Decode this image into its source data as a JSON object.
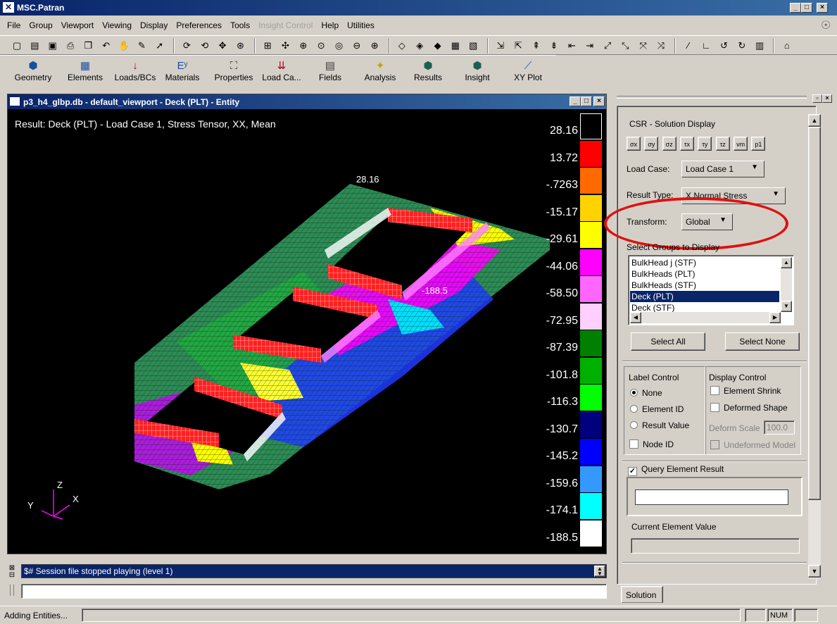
{
  "app": {
    "title": "MSC.Patran"
  },
  "menubar": [
    "File",
    "Group",
    "Viewport",
    "Viewing",
    "Display",
    "Preferences",
    "Tools",
    "Insight Control",
    "Help",
    "Utilities"
  ],
  "appbar": [
    {
      "label": "Geometry",
      "icon": "geometry-icon"
    },
    {
      "label": "Elements",
      "icon": "elements-icon"
    },
    {
      "label": "Loads/BCs",
      "icon": "loads-icon"
    },
    {
      "label": "Materials",
      "icon": "materials-icon"
    },
    {
      "label": "Properties",
      "icon": "properties-icon"
    },
    {
      "label": "Load Ca...",
      "icon": "loadcase-icon"
    },
    {
      "label": "Fields",
      "icon": "fields-icon"
    },
    {
      "label": "Analysis",
      "icon": "analysis-icon"
    },
    {
      "label": "Results",
      "icon": "results-icon"
    },
    {
      "label": "Insight",
      "icon": "insight-icon"
    },
    {
      "label": "XY Plot",
      "icon": "xyplot-icon"
    }
  ],
  "viewport": {
    "title": "p3_h4_glbp.db - default_viewport - Deck (PLT) - Entity",
    "result_text": "Result: Deck (PLT) - Load Case 1, Stress Tensor, XX, Mean",
    "max_marker": "28.16",
    "min_marker": "-188.5",
    "axes": {
      "x": "X",
      "y": "Y",
      "z": "Z"
    }
  },
  "legend": {
    "values": [
      "28.16",
      "13.72",
      "-.7263",
      "-15.17",
      "-29.61",
      "-44.06",
      "-58.50",
      "-72.95",
      "-87.39",
      "-101.8",
      "-116.3",
      "-130.7",
      "-145.2",
      "-159.6",
      "-174.1",
      "-188.5"
    ],
    "colors": [
      "#000000",
      "#ff0000",
      "#ff6a00",
      "#ffd200",
      "#ffff00",
      "#ff00ff",
      "#ff66ff",
      "#ffcfff",
      "#007f00",
      "#00b000",
      "#00ff00",
      "#00007f",
      "#0000ff",
      "#3399ff",
      "#00ffff",
      "#ffffff"
    ]
  },
  "panel": {
    "title": "CSR - Solution Display",
    "load_case_label": "Load Case:",
    "load_case_value": "Load Case 1",
    "result_type_label": "Result Type:",
    "result_type_value": "X Normal Stress",
    "transform_label": "Transform:",
    "transform_value": "Global",
    "groups_label": "Select Groups to Display",
    "groups": [
      "BulkHead j (STF)",
      "BulkHeads (PLT)",
      "BulkHeads (STF)",
      "Deck (PLT)",
      "Deck (STF)"
    ],
    "selected_group": "Deck (PLT)",
    "select_all": "Select All",
    "select_none": "Select None",
    "label_control": "Label Control",
    "label_options": [
      "None",
      "Element ID",
      "Result Value"
    ],
    "label_selected": "None",
    "display_control": "Display Control",
    "element_shrink": "Element Shrink",
    "deformed_shape": "Deformed Shape",
    "deform_scale_label": "Deform Scale",
    "deform_scale_value": "100.0",
    "node_id": "Node ID",
    "undeformed_model": "Undeformed Model",
    "query_element": "Query Element Result",
    "query_checked": true,
    "current_value_label": "Current Element Value",
    "tab": "Solution"
  },
  "console": {
    "message": "$# Session file stopped playing (level 1)"
  },
  "status": {
    "text": "Adding Entities...",
    "num": "NUM"
  }
}
